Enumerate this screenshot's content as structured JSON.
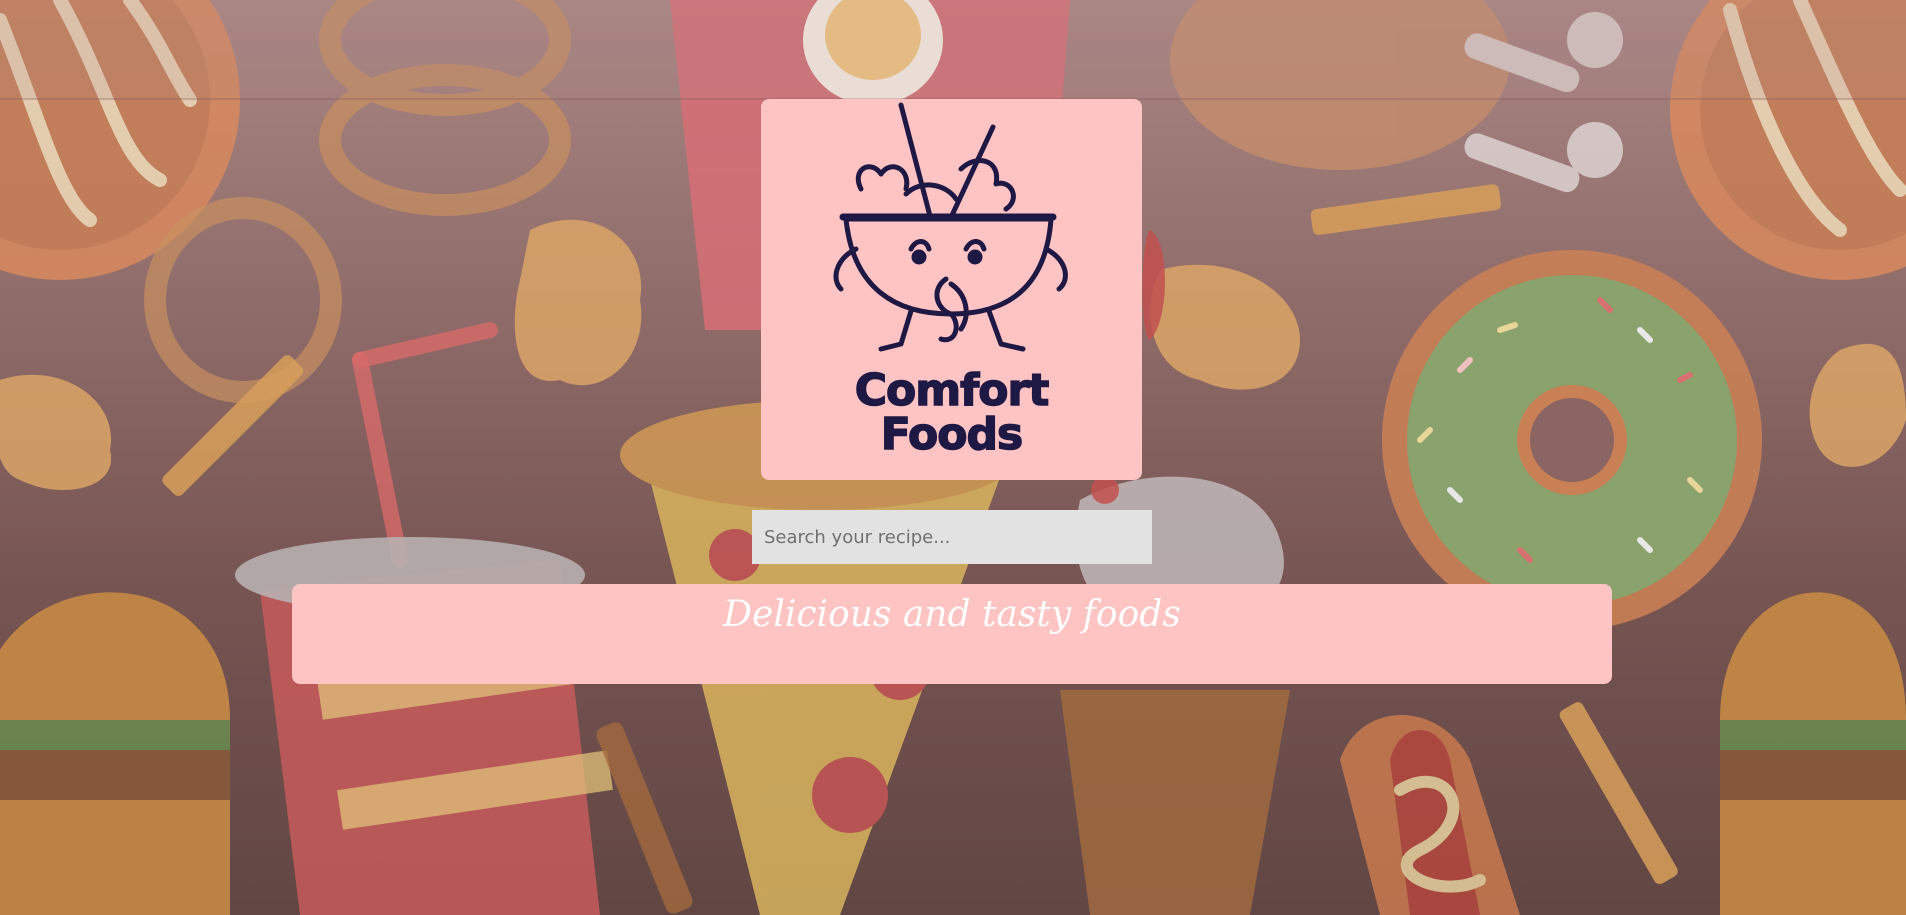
{
  "logo": {
    "line1": "Comfort",
    "line2": "Foods",
    "icon": "noodle-bowl-mascot-icon"
  },
  "search": {
    "placeholder": "Search your recipe...",
    "value": ""
  },
  "tagline": "Delicious and tasty foods",
  "background": {
    "theme": "fast-food-illustration-pattern",
    "items": [
      "donut-icon",
      "onion-ring-icon",
      "fries-icon",
      "drink-cup-icon",
      "pizza-slice-icon",
      "burger-icon",
      "hotdog-icon",
      "ice-cream-icon",
      "chicken-drumstick-icon",
      "chicken-nugget-icon"
    ]
  },
  "colors": {
    "card_bg": "#fec3c3",
    "logo_ink": "#1e1845",
    "input_bg": "#e2e2e2",
    "tagline_text": "#ffffff"
  }
}
